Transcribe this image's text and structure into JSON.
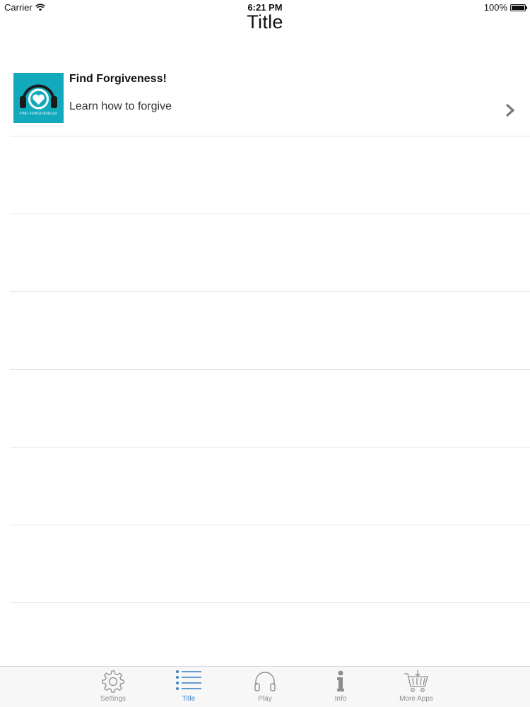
{
  "status_bar": {
    "carrier": "Carrier",
    "time": "6:21 PM",
    "battery": "100%"
  },
  "nav": {
    "title": "Title"
  },
  "list": {
    "items": [
      {
        "title": "Find Forgiveness!",
        "subtitle": "Learn how to forgive",
        "thumbnail_caption": "FIND FORGIVENESS!",
        "thumbnail_color": "#12a9bd"
      }
    ]
  },
  "tab_bar": {
    "active_color": "#3b84c4",
    "inactive_color": "#8d8d92",
    "tabs": [
      {
        "label": "Settings",
        "icon": "gear-icon",
        "active": false
      },
      {
        "label": "Title",
        "icon": "list-icon",
        "active": true
      },
      {
        "label": "Play",
        "icon": "headphones-icon",
        "active": false
      },
      {
        "label": "Info",
        "icon": "info-icon",
        "active": false
      },
      {
        "label": "More Apps",
        "icon": "cart-icon",
        "active": false
      }
    ]
  }
}
